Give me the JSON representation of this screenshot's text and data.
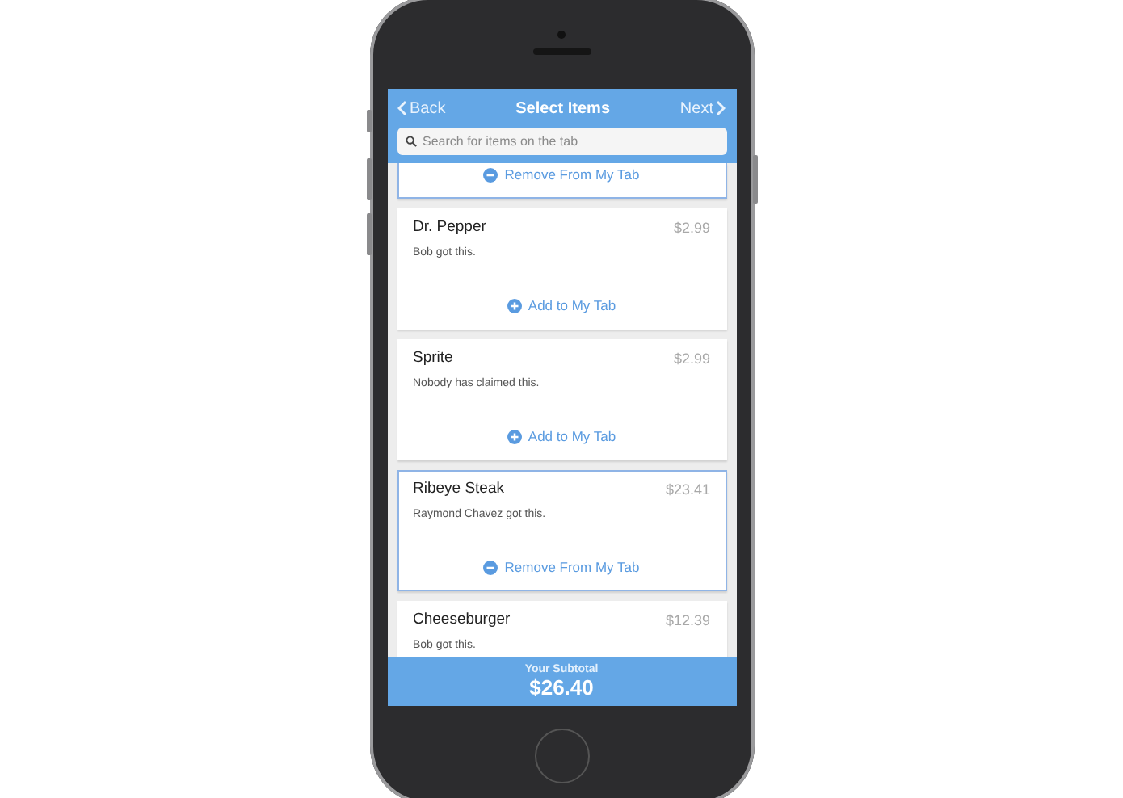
{
  "nav": {
    "back": "Back",
    "title": "Select Items",
    "next": "Next"
  },
  "search": {
    "placeholder": "Search for items on the tab"
  },
  "items": [
    {
      "action": "Remove From My Tab",
      "selected": true
    },
    {
      "name": "Dr. Pepper",
      "price": "$2.99",
      "note": "Bob got this.",
      "action": "Add to My Tab",
      "selected": false
    },
    {
      "name": "Sprite",
      "price": "$2.99",
      "note": "Nobody has claimed this.",
      "action": "Add to My Tab",
      "selected": false
    },
    {
      "name": "Ribeye Steak",
      "price": "$23.41",
      "note": "Raymond Chavez got this.",
      "action": "Remove From My Tab",
      "selected": true
    },
    {
      "name": "Cheeseburger",
      "price": "$12.39",
      "note": "Bob got this.",
      "selected": false
    }
  ],
  "subtotal": {
    "label": "Your Subtotal",
    "amount": "$26.40"
  }
}
